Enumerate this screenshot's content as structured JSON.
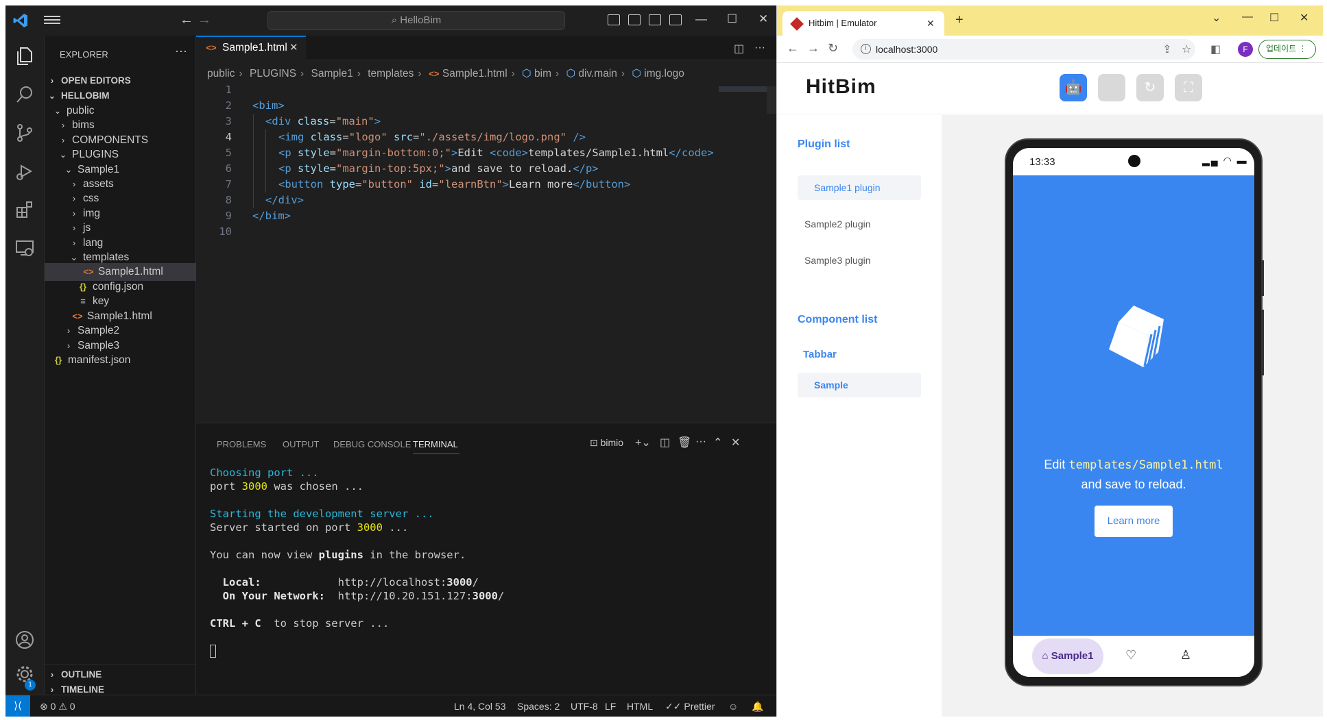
{
  "vscode": {
    "search_text": "HelloBim",
    "explorer": {
      "title": "EXPLORER",
      "more": "···",
      "items": [
        {
          "label": "OPEN EDITORS"
        },
        {
          "label": "HELLOBIM"
        },
        {
          "label": "public"
        },
        {
          "label": "bims"
        },
        {
          "label": "COMPONENTS"
        },
        {
          "label": "PLUGINS"
        },
        {
          "label": "Sample1"
        },
        {
          "label": "assets"
        },
        {
          "label": "css"
        },
        {
          "label": "img"
        },
        {
          "label": "js"
        },
        {
          "label": "lang"
        },
        {
          "label": "templates"
        },
        {
          "label": "Sample1.html"
        },
        {
          "label": "config.json"
        },
        {
          "label": "key"
        },
        {
          "label": "Sample1.html"
        },
        {
          "label": "Sample2"
        },
        {
          "label": "Sample3"
        },
        {
          "label": "manifest.json"
        }
      ],
      "outline": "OUTLINE",
      "timeline": "TIMELINE"
    },
    "tab": {
      "label": "Sample1.html",
      "close": "✕"
    },
    "breadcrumb": [
      "public",
      "PLUGINS",
      "Sample1",
      "templates",
      "Sample1.html",
      "bim",
      "div.main",
      "img.logo"
    ],
    "code": {
      "line_numbers": [
        "1",
        "2",
        "3",
        "4",
        "5",
        "6",
        "7",
        "8",
        "9",
        "10"
      ],
      "line2": "<bim>",
      "line3_tag": "<div ",
      "line3_attr": "class",
      "line3_eq": "=",
      "line3_val": "\"main\"",
      "line3_end": ">",
      "line4_tag": "<img ",
      "line4_a1": "class",
      "line4_v1": "\"logo\"",
      "line4_a2": "src",
      "line4_v2": "\"./assets/img/logo.png\"",
      "line4_end": " />",
      "line5_tag": "<p ",
      "line5_attr": "style",
      "line5_val": "\"margin-bottom:0;\"",
      "line5_gt": ">",
      "line5_text": "Edit ",
      "line5_code_open": "<code>",
      "line5_code_text": "templates/Sample1.html",
      "line5_code_close": "</code>",
      "line6_tag": "<p ",
      "line6_attr": "style",
      "line6_val": "\"margin-top:5px;\"",
      "line6_gt": ">",
      "line6_text": "and save to reload.",
      "line6_close": "</p>",
      "line7_tag": "<button ",
      "line7_a1": "type",
      "line7_v1": "\"button\"",
      "line7_a2": "id",
      "line7_v2": "\"learnBtn\"",
      "line7_gt": ">",
      "line7_text": "Learn more",
      "line7_close": "</button>",
      "line8": "</div>",
      "line9": "</bim>"
    },
    "panel": {
      "tabs": [
        "PROBLEMS",
        "OUTPUT",
        "DEBUG CONSOLE",
        "TERMINAL"
      ],
      "terminal_name": "bimio",
      "terminal": {
        "l1": "Choosing port ...",
        "l2_a": "port ",
        "l2_b": "3000",
        "l2_c": " was chosen ...",
        "l3": "Starting the development server ...",
        "l4_a": "Server started on port ",
        "l4_b": "3000",
        "l4_c": " ...",
        "l5_a": "You can now view ",
        "l5_b": "plugins",
        "l5_c": " in the browser.",
        "l6_label": "  Local:",
        "l6_pad": "            ",
        "l6_url_a": "http://localhost:",
        "l6_url_b": "3000",
        "l6_url_c": "/",
        "l7_label": "  On Your Network:",
        "l7_pad": "  ",
        "l7_url_a": "http://10.20.151.127:",
        "l7_url_b": "3000",
        "l7_url_c": "/",
        "l8_a": "CTRL + C",
        "l8_b": "  to stop server ..."
      }
    },
    "status": {
      "errors": "0",
      "warnings": "0",
      "position": "Ln 4, Col 53",
      "spaces": "Spaces: 2",
      "encoding": "UTF-8",
      "eol": "LF",
      "language": "HTML",
      "formatter": "Prettier",
      "settings_badge": "1"
    }
  },
  "browser": {
    "tab_title": "Hitbim | Emulator",
    "url": "localhost:3000",
    "profile": "F",
    "update_label": "업데이트",
    "app": {
      "logo": "HitBim",
      "plugin_list_title": "Plugin list",
      "plugins": [
        "Sample1 plugin",
        "Sample2 plugin",
        "Sample3 plugin"
      ],
      "component_list_title": "Component list",
      "components": [
        "Tabbar",
        "Sample"
      ],
      "phone": {
        "time": "13:33",
        "edit_prefix": "Edit ",
        "edit_code": "templates/Sample1.html",
        "edit_suffix": "and save to reload.",
        "button": "Learn more",
        "nav_home": "Sample1"
      }
    }
  }
}
